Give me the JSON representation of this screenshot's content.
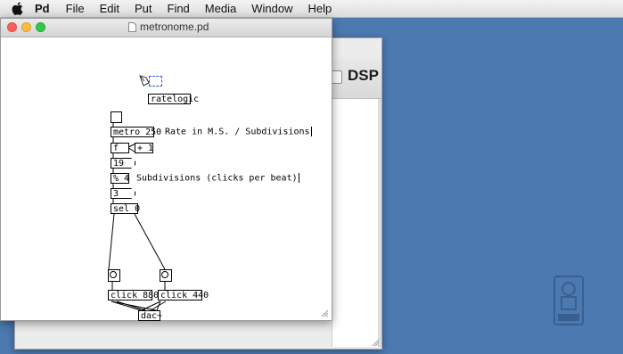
{
  "menubar": {
    "app": "Pd",
    "items": [
      "File",
      "Edit",
      "Put",
      "Find",
      "Media",
      "Window",
      "Help"
    ]
  },
  "main_window": {
    "dsp_label": "DSP",
    "dsp_checked": false
  },
  "patch_window": {
    "title": "metronome.pd"
  },
  "patch": {
    "objects": {
      "ratelogic": "ratelogic",
      "metro": "metro 250",
      "f": "f",
      "plus1": "+ 1",
      "mod4": "% 4",
      "sel0": "sel 0",
      "click880": "click 880",
      "click440": "click 440",
      "dac": "dac~"
    },
    "messages": {
      "count_display": "19",
      "mod_display": "3"
    },
    "comments": {
      "rate": "Rate in M.S. / Subdivisions",
      "subdivisions": "Subdivisions (clicks per beat)"
    }
  },
  "watermark": {
    "icon": "learn-logo"
  }
}
